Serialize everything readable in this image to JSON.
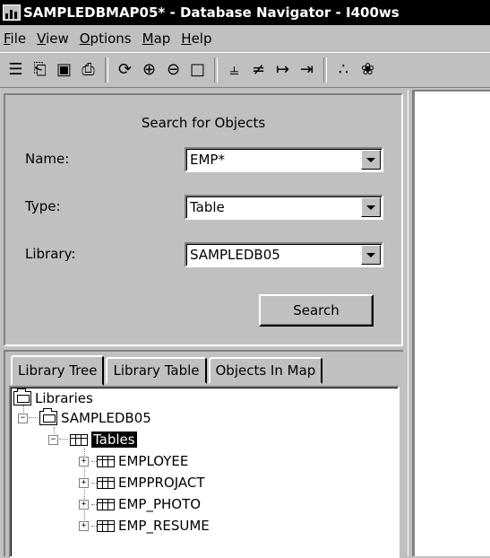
{
  "window": {
    "title": "SAMPLEDBMAP05* - Database Navigator - I400ws"
  },
  "menu": [
    {
      "label": "File",
      "mnemonic": "F",
      "rest": "ile"
    },
    {
      "label": "View",
      "mnemonic": "V",
      "rest": "iew"
    },
    {
      "label": "Options",
      "mnemonic": "O",
      "rest": "ptions"
    },
    {
      "label": "Map",
      "mnemonic": "M",
      "rest": "ap"
    },
    {
      "label": "Help",
      "mnemonic": "H",
      "rest": "elp"
    }
  ],
  "toolbar": [
    {
      "name": "new-icon",
      "glyph": "☰"
    },
    {
      "name": "open-icon",
      "glyph": "⎗"
    },
    {
      "name": "save-icon",
      "glyph": "▣"
    },
    {
      "name": "print-icon",
      "glyph": "⎙"
    },
    {
      "sep": true
    },
    {
      "name": "refresh-icon",
      "glyph": "⟳"
    },
    {
      "name": "zoom-in-icon",
      "glyph": "⊕"
    },
    {
      "name": "zoom-out-icon",
      "glyph": "⊖"
    },
    {
      "name": "fit-icon",
      "glyph": "□"
    },
    {
      "sep": true
    },
    {
      "name": "align-vertical-icon",
      "glyph": "⫨"
    },
    {
      "name": "align-center-icon",
      "glyph": "≠"
    },
    {
      "name": "spread-horizontal-icon",
      "glyph": "↦"
    },
    {
      "name": "compress-horizontal-icon",
      "glyph": "⇥"
    },
    {
      "sep": true
    },
    {
      "name": "layout-icon",
      "glyph": "∴"
    },
    {
      "name": "properties-icon",
      "glyph": "❀"
    }
  ],
  "search": {
    "heading": "Search for Objects",
    "name_label": "Name:",
    "name_value": "EMP*",
    "type_label": "Type:",
    "type_value": "Table",
    "library_label": "Library:",
    "library_value": "SAMPLEDB05",
    "button_label": "Search"
  },
  "tabs": {
    "library_tree": "Library Tree",
    "library_table": "Library Table",
    "objects_in_map": "Objects In Map"
  },
  "tree": {
    "root": "Libraries",
    "library": "SAMPLEDB05",
    "folder": "Tables",
    "expander_open": "−",
    "expander_closed": "+",
    "items": [
      "EMPLOYEE",
      "EMPPROJACT",
      "EMP_PHOTO",
      "EMP_RESUME"
    ]
  }
}
